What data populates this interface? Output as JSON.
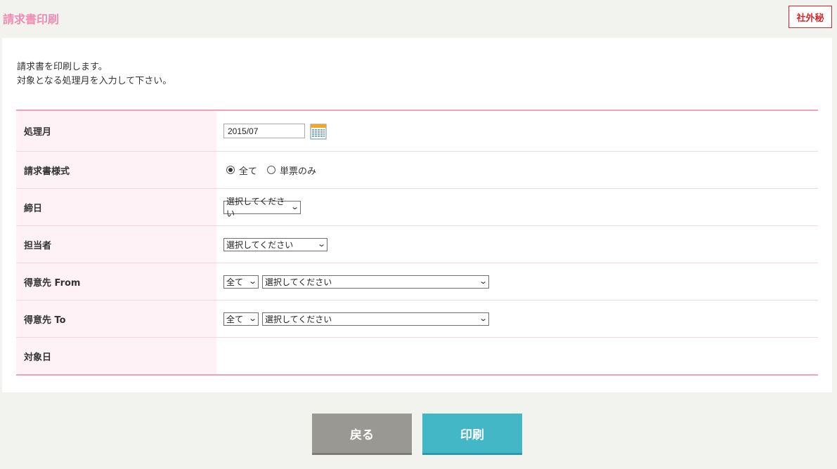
{
  "header": {
    "title": "請求書印刷",
    "badge": "社外秘"
  },
  "intro": {
    "line1": "請求書を印刷します。",
    "line2": "対象となる処理月を入力して下さい。"
  },
  "form": {
    "month": {
      "label": "処理月",
      "value": "2015/07"
    },
    "format": {
      "label": "請求書様式",
      "options": [
        "全て",
        "単票のみ"
      ],
      "selected": "全て"
    },
    "closing_day": {
      "label": "締日",
      "selected": "選択してください"
    },
    "staff": {
      "label": "担当者",
      "selected": "選択してください"
    },
    "customer_from": {
      "label": "得意先 From",
      "scope": "全て",
      "selected": "選択してください"
    },
    "customer_to": {
      "label": "得意先 To",
      "scope": "全て",
      "selected": "選択してください"
    },
    "target_day": {
      "label": "対象日",
      "value": ""
    }
  },
  "buttons": {
    "back": "戻る",
    "print": "印刷"
  },
  "colors": {
    "title": "#f08cb4",
    "badge": "#d42828",
    "table_border": "#f2a0c0",
    "label_bg": "#fff2f7",
    "back_button": "#999893",
    "print_button": "#44b7c7"
  },
  "icons": {
    "calendar": "calendar-icon",
    "dropdown": "chevron-down-icon"
  }
}
